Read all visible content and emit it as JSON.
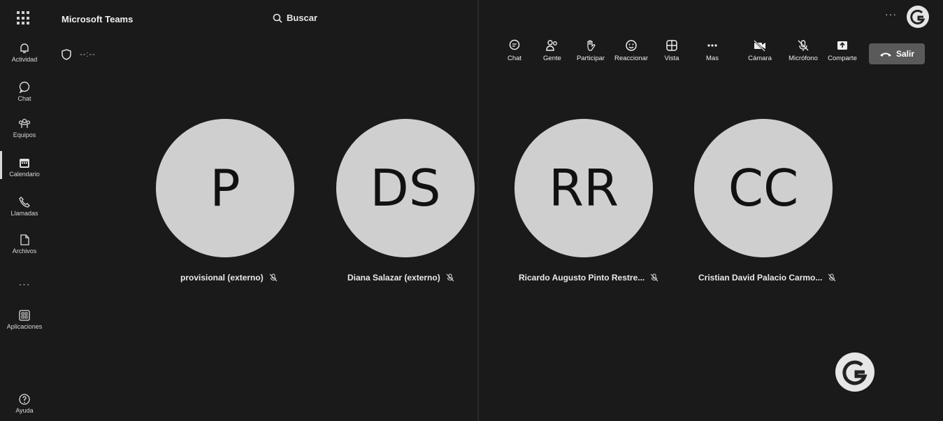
{
  "topbar": {
    "app_title": "Microsoft Teams",
    "search_label": "Buscar",
    "more_label": "···"
  },
  "rail": {
    "items": [
      {
        "label": "Actividad",
        "icon": "bell-icon"
      },
      {
        "label": "Chat",
        "icon": "chat-icon"
      },
      {
        "label": "Equipos",
        "icon": "teams-icon"
      },
      {
        "label": "Calendario",
        "icon": "calendar-icon"
      },
      {
        "label": "Llamadas",
        "icon": "phone-icon"
      },
      {
        "label": "Archivos",
        "icon": "file-icon"
      },
      {
        "label": "Aplicaciones",
        "icon": "apps-icon"
      },
      {
        "label": "Ayuda",
        "icon": "help-icon"
      }
    ],
    "more_label": "···"
  },
  "meeting": {
    "timer": "--:--"
  },
  "toolbar": {
    "chat": "Chat",
    "people": "Gente",
    "raise_hand": "Participar",
    "react": "Reaccionar",
    "view": "Vista",
    "more": "Mas",
    "camera": "Cámara",
    "mic": "Micrófono",
    "share": "Comparte",
    "leave": "Salir"
  },
  "participants": [
    {
      "initials": "P",
      "name": "provisional (externo)"
    },
    {
      "initials": "DS",
      "name": "Diana Salazar (externo)"
    },
    {
      "initials": "RR",
      "name": "Ricardo Augusto Pinto Restre..."
    },
    {
      "initials": "CC",
      "name": "Cristian David Palacio Carmo..."
    }
  ],
  "colors": {
    "background": "#1a1a1a",
    "avatar": "#cfcfcf",
    "leave_button": "#5a5a5a"
  }
}
